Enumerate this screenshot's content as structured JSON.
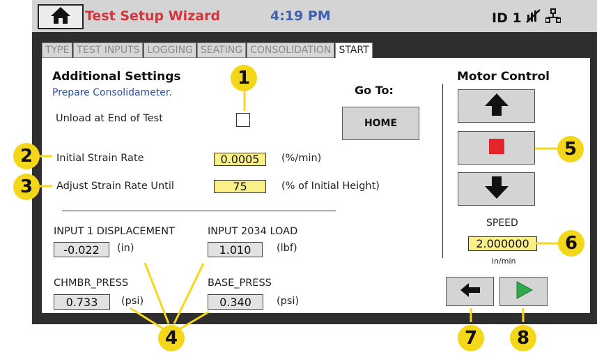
{
  "header": {
    "title": "Test Setup Wizard",
    "time": "4:19 PM",
    "device_id": "ID 1",
    "icons": [
      "home-icon",
      "no-network-icon",
      "network-icon"
    ]
  },
  "tabs": [
    {
      "label": "TYPE",
      "active": false
    },
    {
      "label": "TEST INPUTS",
      "active": false
    },
    {
      "label": "LOGGING",
      "active": false
    },
    {
      "label": "SEATING",
      "active": false
    },
    {
      "label": "CONSOLIDATION",
      "active": false
    },
    {
      "label": "START",
      "active": true
    }
  ],
  "settings": {
    "heading": "Additional Settings",
    "subtitle": "Prepare Consolidameter.",
    "unload_label": "Unload at End of Test",
    "unload_checked": false,
    "strain_rate_label": "Initial Strain Rate",
    "strain_rate_value": "0.0005",
    "strain_rate_unit": "(%/min)",
    "adjust_label": "Adjust Strain Rate Until",
    "adjust_value": "75",
    "adjust_unit": "(% of Initial Height)"
  },
  "goto": {
    "label": "Go To:",
    "home_button": "HOME"
  },
  "readings": [
    {
      "label": "INPUT 1 DISPLACEMENT",
      "value": "-0.022",
      "unit": "(in)"
    },
    {
      "label": "INPUT 2034 LOAD",
      "value": "1.010",
      "unit": "(lbf)"
    },
    {
      "label": "CHMBR_PRESS",
      "value": "0.733",
      "unit": "(psi)"
    },
    {
      "label": "BASE_PRESS",
      "value": "0.340",
      "unit": "(psi)"
    }
  ],
  "motor": {
    "heading": "Motor Control",
    "speed_label": "SPEED",
    "speed_value": "2.000000",
    "speed_unit": "in/min",
    "stop_color": "#e5242b",
    "play_color": "#2eaa4a"
  },
  "callouts": [
    "1",
    "2",
    "3",
    "4",
    "5",
    "6",
    "7",
    "8"
  ],
  "colors": {
    "accent_yellow": "#f4d61a",
    "title_red": "#d8323a",
    "time_blue": "#3f5fb0",
    "input_yellow": "#faf08a"
  }
}
